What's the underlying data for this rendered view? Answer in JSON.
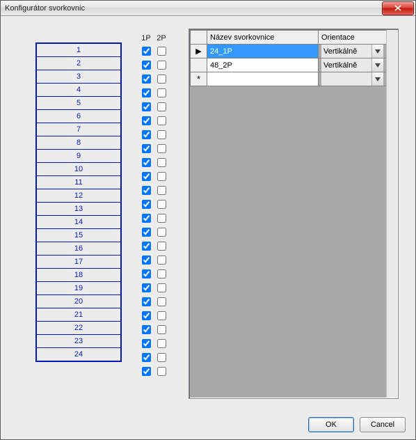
{
  "window": {
    "title": "Konfigurátor svorkovnic"
  },
  "headers": {
    "col_1p": "1P",
    "col_2p": "2P"
  },
  "terminals": [
    {
      "n": "1",
      "p1": true,
      "p2": false
    },
    {
      "n": "2",
      "p1": true,
      "p2": false
    },
    {
      "n": "3",
      "p1": true,
      "p2": false
    },
    {
      "n": "4",
      "p1": true,
      "p2": false
    },
    {
      "n": "5",
      "p1": true,
      "p2": false
    },
    {
      "n": "6",
      "p1": true,
      "p2": false
    },
    {
      "n": "7",
      "p1": true,
      "p2": false
    },
    {
      "n": "8",
      "p1": true,
      "p2": false
    },
    {
      "n": "9",
      "p1": true,
      "p2": false
    },
    {
      "n": "10",
      "p1": true,
      "p2": false
    },
    {
      "n": "11",
      "p1": true,
      "p2": false
    },
    {
      "n": "12",
      "p1": true,
      "p2": false
    },
    {
      "n": "13",
      "p1": true,
      "p2": false
    },
    {
      "n": "14",
      "p1": true,
      "p2": false
    },
    {
      "n": "15",
      "p1": true,
      "p2": false
    },
    {
      "n": "16",
      "p1": true,
      "p2": false
    },
    {
      "n": "17",
      "p1": true,
      "p2": false
    },
    {
      "n": "18",
      "p1": true,
      "p2": false
    },
    {
      "n": "19",
      "p1": true,
      "p2": false
    },
    {
      "n": "20",
      "p1": true,
      "p2": false
    },
    {
      "n": "21",
      "p1": true,
      "p2": false
    },
    {
      "n": "22",
      "p1": true,
      "p2": false
    },
    {
      "n": "23",
      "p1": true,
      "p2": false
    },
    {
      "n": "24",
      "p1": true,
      "p2": false
    }
  ],
  "grid": {
    "columns": {
      "name": "Název svorkovnice",
      "orientation": "Orientace"
    },
    "rows": [
      {
        "selector": "▶",
        "name": "24_1P",
        "orientation": "Vertikálně",
        "selected": true
      },
      {
        "selector": "",
        "name": "48_2P",
        "orientation": "Vertikálně",
        "selected": false
      }
    ],
    "new_row_marker": "*"
  },
  "buttons": {
    "ok": "OK",
    "cancel": "Cancel"
  }
}
